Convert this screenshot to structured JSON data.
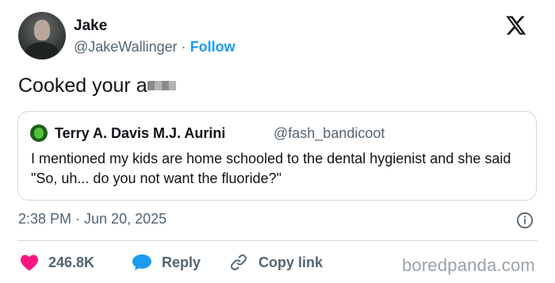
{
  "author": {
    "name": "Jake",
    "handle": "@JakeWallinger",
    "separator": "·",
    "follow_label": "Follow"
  },
  "tweet": {
    "text": "Cooked your a"
  },
  "quote": {
    "name": "Terry A. Davis M.J. Aurini",
    "handle": "@fash_bandicoot",
    "text": "I mentioned my kids are home schooled to the dental hygienist and she said \"So, uh... do you not want the fluoride?\""
  },
  "meta": {
    "timestamp": "2:38 PM · Jun 20, 2025"
  },
  "actions": {
    "like_count": "246.8K",
    "reply_label": "Reply",
    "copy_link_label": "Copy link"
  },
  "watermark": "boredpanda.com",
  "icons": {
    "x_logo": "x-logo-icon",
    "info": "info-icon",
    "like": "heart-icon",
    "reply": "speech-bubble-icon",
    "link": "link-icon"
  },
  "colors": {
    "text": "#0f1419",
    "secondary": "#536471",
    "accent": "#1d9bf0",
    "like": "#f91880",
    "border": "#cfd9de"
  }
}
